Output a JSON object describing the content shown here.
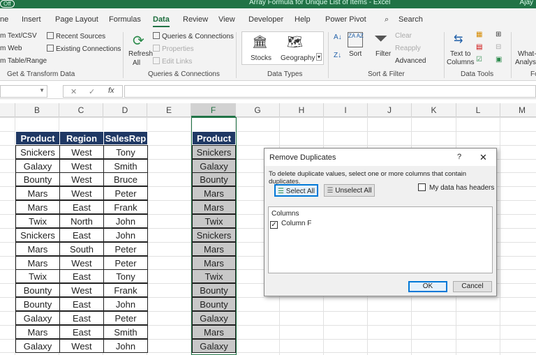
{
  "titlebar": {
    "autosave": "Off",
    "title": "Array Formula for Unique List of Items  -  Excel",
    "user": "Ajay"
  },
  "tabs": [
    "ne",
    "Insert",
    "Page Layout",
    "Formulas",
    "Data",
    "Review",
    "View",
    "Developer",
    "Help",
    "Power Pivot",
    "Search"
  ],
  "ribbon": {
    "get_transform": {
      "items": [
        "m Text/CSV",
        "m Web",
        "m Table/Range",
        "Recent Sources",
        "Existing Connections"
      ],
      "label": "Get & Transform Data"
    },
    "queries": {
      "refresh": "Refresh",
      "all": "All",
      "items": [
        "Queries & Connections",
        "Properties",
        "Edit Links"
      ],
      "label": "Queries & Connections"
    },
    "data_types": {
      "stocks": "Stocks",
      "geography": "Geography",
      "label": "Data Types"
    },
    "sort_filter": {
      "sort": "Sort",
      "filter": "Filter",
      "clear": "Clear",
      "reapply": "Reapply",
      "advanced": "Advanced",
      "label": "Sort & Filter"
    },
    "data_tools": {
      "text_to": "Text to",
      "columns": "Columns",
      "label": "Data Tools"
    },
    "whatif": {
      "l1": "What-",
      "l2": "Analysi",
      "label": "Fo"
    }
  },
  "formula_bar": {
    "fx": "fx",
    "value": ""
  },
  "columns": [
    "B",
    "C",
    "D",
    "E",
    "F",
    "G",
    "H",
    "I",
    "J",
    "K",
    "L",
    "M"
  ],
  "table": {
    "headers": [
      "Product",
      "Region",
      "SalesRep"
    ],
    "rows": [
      [
        "Snickers",
        "West",
        "Tony"
      ],
      [
        "Galaxy",
        "West",
        "Smith"
      ],
      [
        "Bounty",
        "West",
        "Bruce"
      ],
      [
        "Mars",
        "West",
        "Peter"
      ],
      [
        "Mars",
        "East",
        "Frank"
      ],
      [
        "Twix",
        "North",
        "John"
      ],
      [
        "Snickers",
        "East",
        "John"
      ],
      [
        "Mars",
        "South",
        "Peter"
      ],
      [
        "Mars",
        "West",
        "Peter"
      ],
      [
        "Twix",
        "East",
        "Tony"
      ],
      [
        "Bounty",
        "West",
        "Frank"
      ],
      [
        "Bounty",
        "East",
        "John"
      ],
      [
        "Galaxy",
        "East",
        "Peter"
      ],
      [
        "Mars",
        "East",
        "Smith"
      ],
      [
        "Galaxy",
        "West",
        "John"
      ]
    ]
  },
  "colF": {
    "header": "Product"
  },
  "dialog": {
    "title": "Remove Duplicates",
    "help": "?",
    "close": "✕",
    "instruction": "To delete duplicate values, select one or more columns that contain duplicates.",
    "select_all": "Select All",
    "unselect_all": "Unselect All",
    "headers_label": "My data has headers",
    "headers_checked": false,
    "columns_label": "Columns",
    "columns": [
      {
        "label": "Column F",
        "checked": true
      }
    ],
    "ok": "OK",
    "cancel": "Cancel"
  },
  "colors": {
    "excel_green": "#217346",
    "table_header": "#1f3864",
    "selected_cell": "#c8c8c8"
  }
}
